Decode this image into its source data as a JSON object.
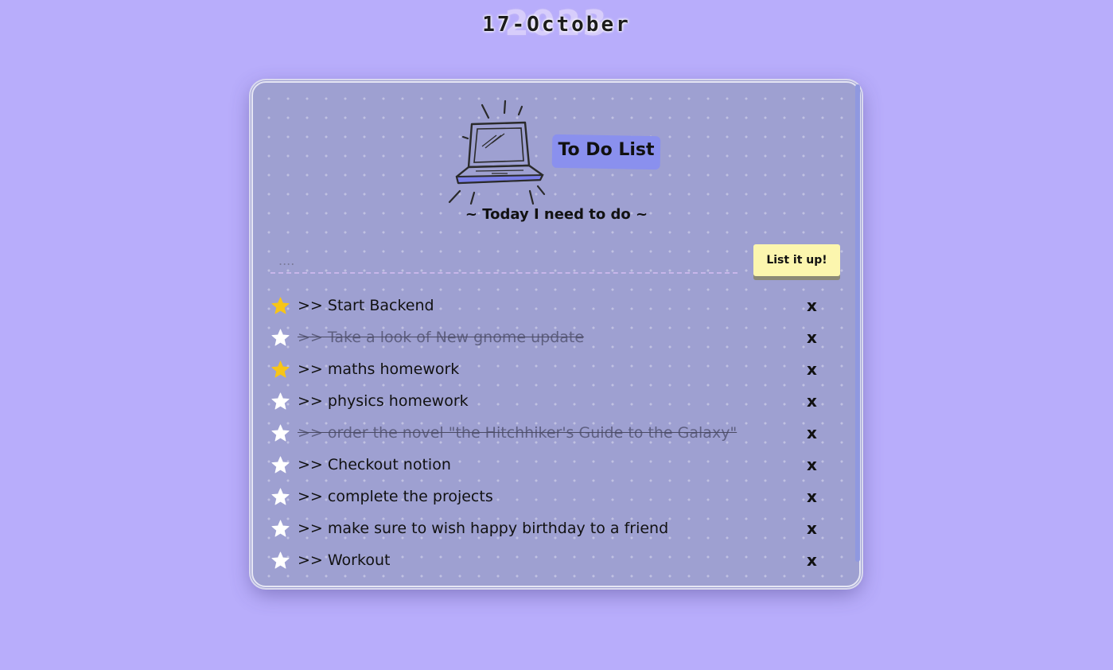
{
  "header": {
    "year": "2023",
    "date": "17-October"
  },
  "card": {
    "title": "To Do List",
    "subtitle": "~ Today I need to do ~",
    "illustration_icon": "laptop-icon"
  },
  "input": {
    "placeholder": "....",
    "value": ""
  },
  "add_button": {
    "label": "List it up!"
  },
  "todos": [
    {
      "text": ">> Start Backend",
      "starred": true,
      "done": false
    },
    {
      "text": ">> Take a look of New gnome update",
      "starred": false,
      "done": true
    },
    {
      "text": ">> maths homework",
      "starred": true,
      "done": false
    },
    {
      "text": ">> physics homework",
      "starred": false,
      "done": false
    },
    {
      "text": ">> order the novel \"the Hitchhiker's Guide to the Galaxy\"",
      "starred": false,
      "done": true
    },
    {
      "text": ">> Checkout notion",
      "starred": false,
      "done": false
    },
    {
      "text": ">> complete the projects",
      "starred": false,
      "done": false
    },
    {
      "text": ">> make sure to wish happy birthday to a friend",
      "starred": false,
      "done": false
    },
    {
      "text": ">> Workout",
      "starred": false,
      "done": false
    }
  ],
  "delete_label": "x",
  "colors": {
    "background": "#b8adfb",
    "card": "#9ea0d1",
    "title_highlight": "#8a90ee",
    "button": "#fcf6ae",
    "star_active": "#f7c517",
    "star_inactive": "#ffffff"
  }
}
